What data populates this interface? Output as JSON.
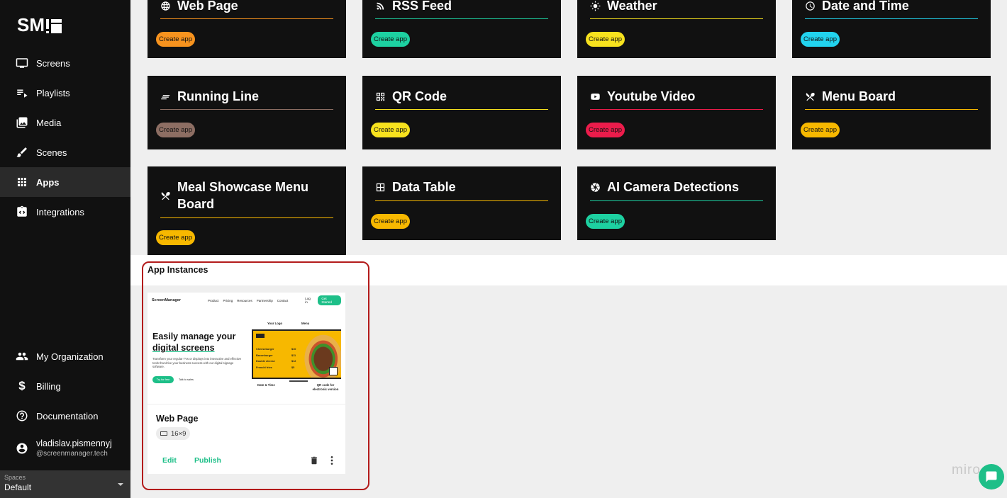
{
  "sidebar": {
    "logo_text": "SM",
    "nav": [
      {
        "label": "Screens",
        "icon": "monitor-icon"
      },
      {
        "label": "Playlists",
        "icon": "playlist-icon"
      },
      {
        "label": "Media",
        "icon": "media-icon"
      },
      {
        "label": "Scenes",
        "icon": "brush-icon"
      },
      {
        "label": "Apps",
        "icon": "apps-grid-icon",
        "active": true
      },
      {
        "label": "Integrations",
        "icon": "integrations-icon"
      }
    ],
    "bottom": [
      {
        "label": "My Organization",
        "icon": "people-icon"
      },
      {
        "label": "Billing",
        "icon": "dollar-icon"
      },
      {
        "label": "Documentation",
        "icon": "help-icon"
      }
    ],
    "user": {
      "name": "vladislav.pismennyj",
      "domain": "@screenmanager.tech",
      "icon": "account-icon"
    },
    "spaces": {
      "label": "Spaces",
      "value": "Default"
    }
  },
  "apps": [
    {
      "title": "Web Page",
      "icon": "globe-icon",
      "accent": "#f7931e",
      "button": "Create app"
    },
    {
      "title": "RSS Feed",
      "icon": "rss-icon",
      "accent": "#1dd1a1",
      "button": "Create app"
    },
    {
      "title": "Weather",
      "icon": "sun-icon",
      "accent": "#f7e21e",
      "button": "Create app"
    },
    {
      "title": "Date and Time",
      "icon": "clock-icon",
      "accent": "#22d3ee",
      "button": "Create app"
    },
    {
      "title": "Running Line",
      "icon": "lines-icon",
      "accent": "#8d6e63",
      "button": "Create app"
    },
    {
      "title": "QR Code",
      "icon": "qr-icon",
      "accent": "#f7e21e",
      "button": "Create app"
    },
    {
      "title": "Youtube Video",
      "icon": "youtube-icon",
      "accent": "#ec1c4b",
      "button": "Create app"
    },
    {
      "title": "Menu Board",
      "icon": "cutlery-icon",
      "accent": "#f7b800",
      "button": "Create app"
    },
    {
      "title": "Meal Showcase Menu Board",
      "icon": "cutlery-icon",
      "accent": "#f7b800",
      "button": "Create app"
    },
    {
      "title": "Data Table",
      "icon": "table-icon",
      "accent": "#f7b800",
      "button": "Create app"
    },
    {
      "title": "AI Camera Detections",
      "icon": "aperture-icon",
      "accent": "#1dd1a1",
      "button": "Create app"
    }
  ],
  "instances": {
    "heading": "App Instances",
    "items": [
      {
        "name": "Web Page",
        "ratio": "16×9",
        "edit_label": "Edit",
        "publish_label": "Publish",
        "preview": {
          "brand": "ScreenManager",
          "nav_links": [
            "Product",
            "Pricing",
            "Resources",
            "Partnership",
            "Contact"
          ],
          "login": "Log in",
          "cta": "Get Started",
          "headline_1": "Easily manage your",
          "headline_2": "digital screens",
          "paragraph": "Transform your regular TVs or displays into interactive and effective tools that drive your business success with our digital signage software.",
          "try_btn": "Try for free",
          "talk_btn": "Talk to sales",
          "callouts": [
            "Your Logo",
            "Menu",
            "Date & Time",
            "QR code for electronic version"
          ],
          "menu_items": [
            {
              "item": "Cheeseburger",
              "price": "$10"
            },
            {
              "item": "Baconburger",
              "price": "$11"
            },
            {
              "item": "Double cheese",
              "price": "$12"
            },
            {
              "item": "Frenchi fries",
              "price": "$5"
            }
          ]
        }
      }
    ]
  },
  "watermark": "miro"
}
